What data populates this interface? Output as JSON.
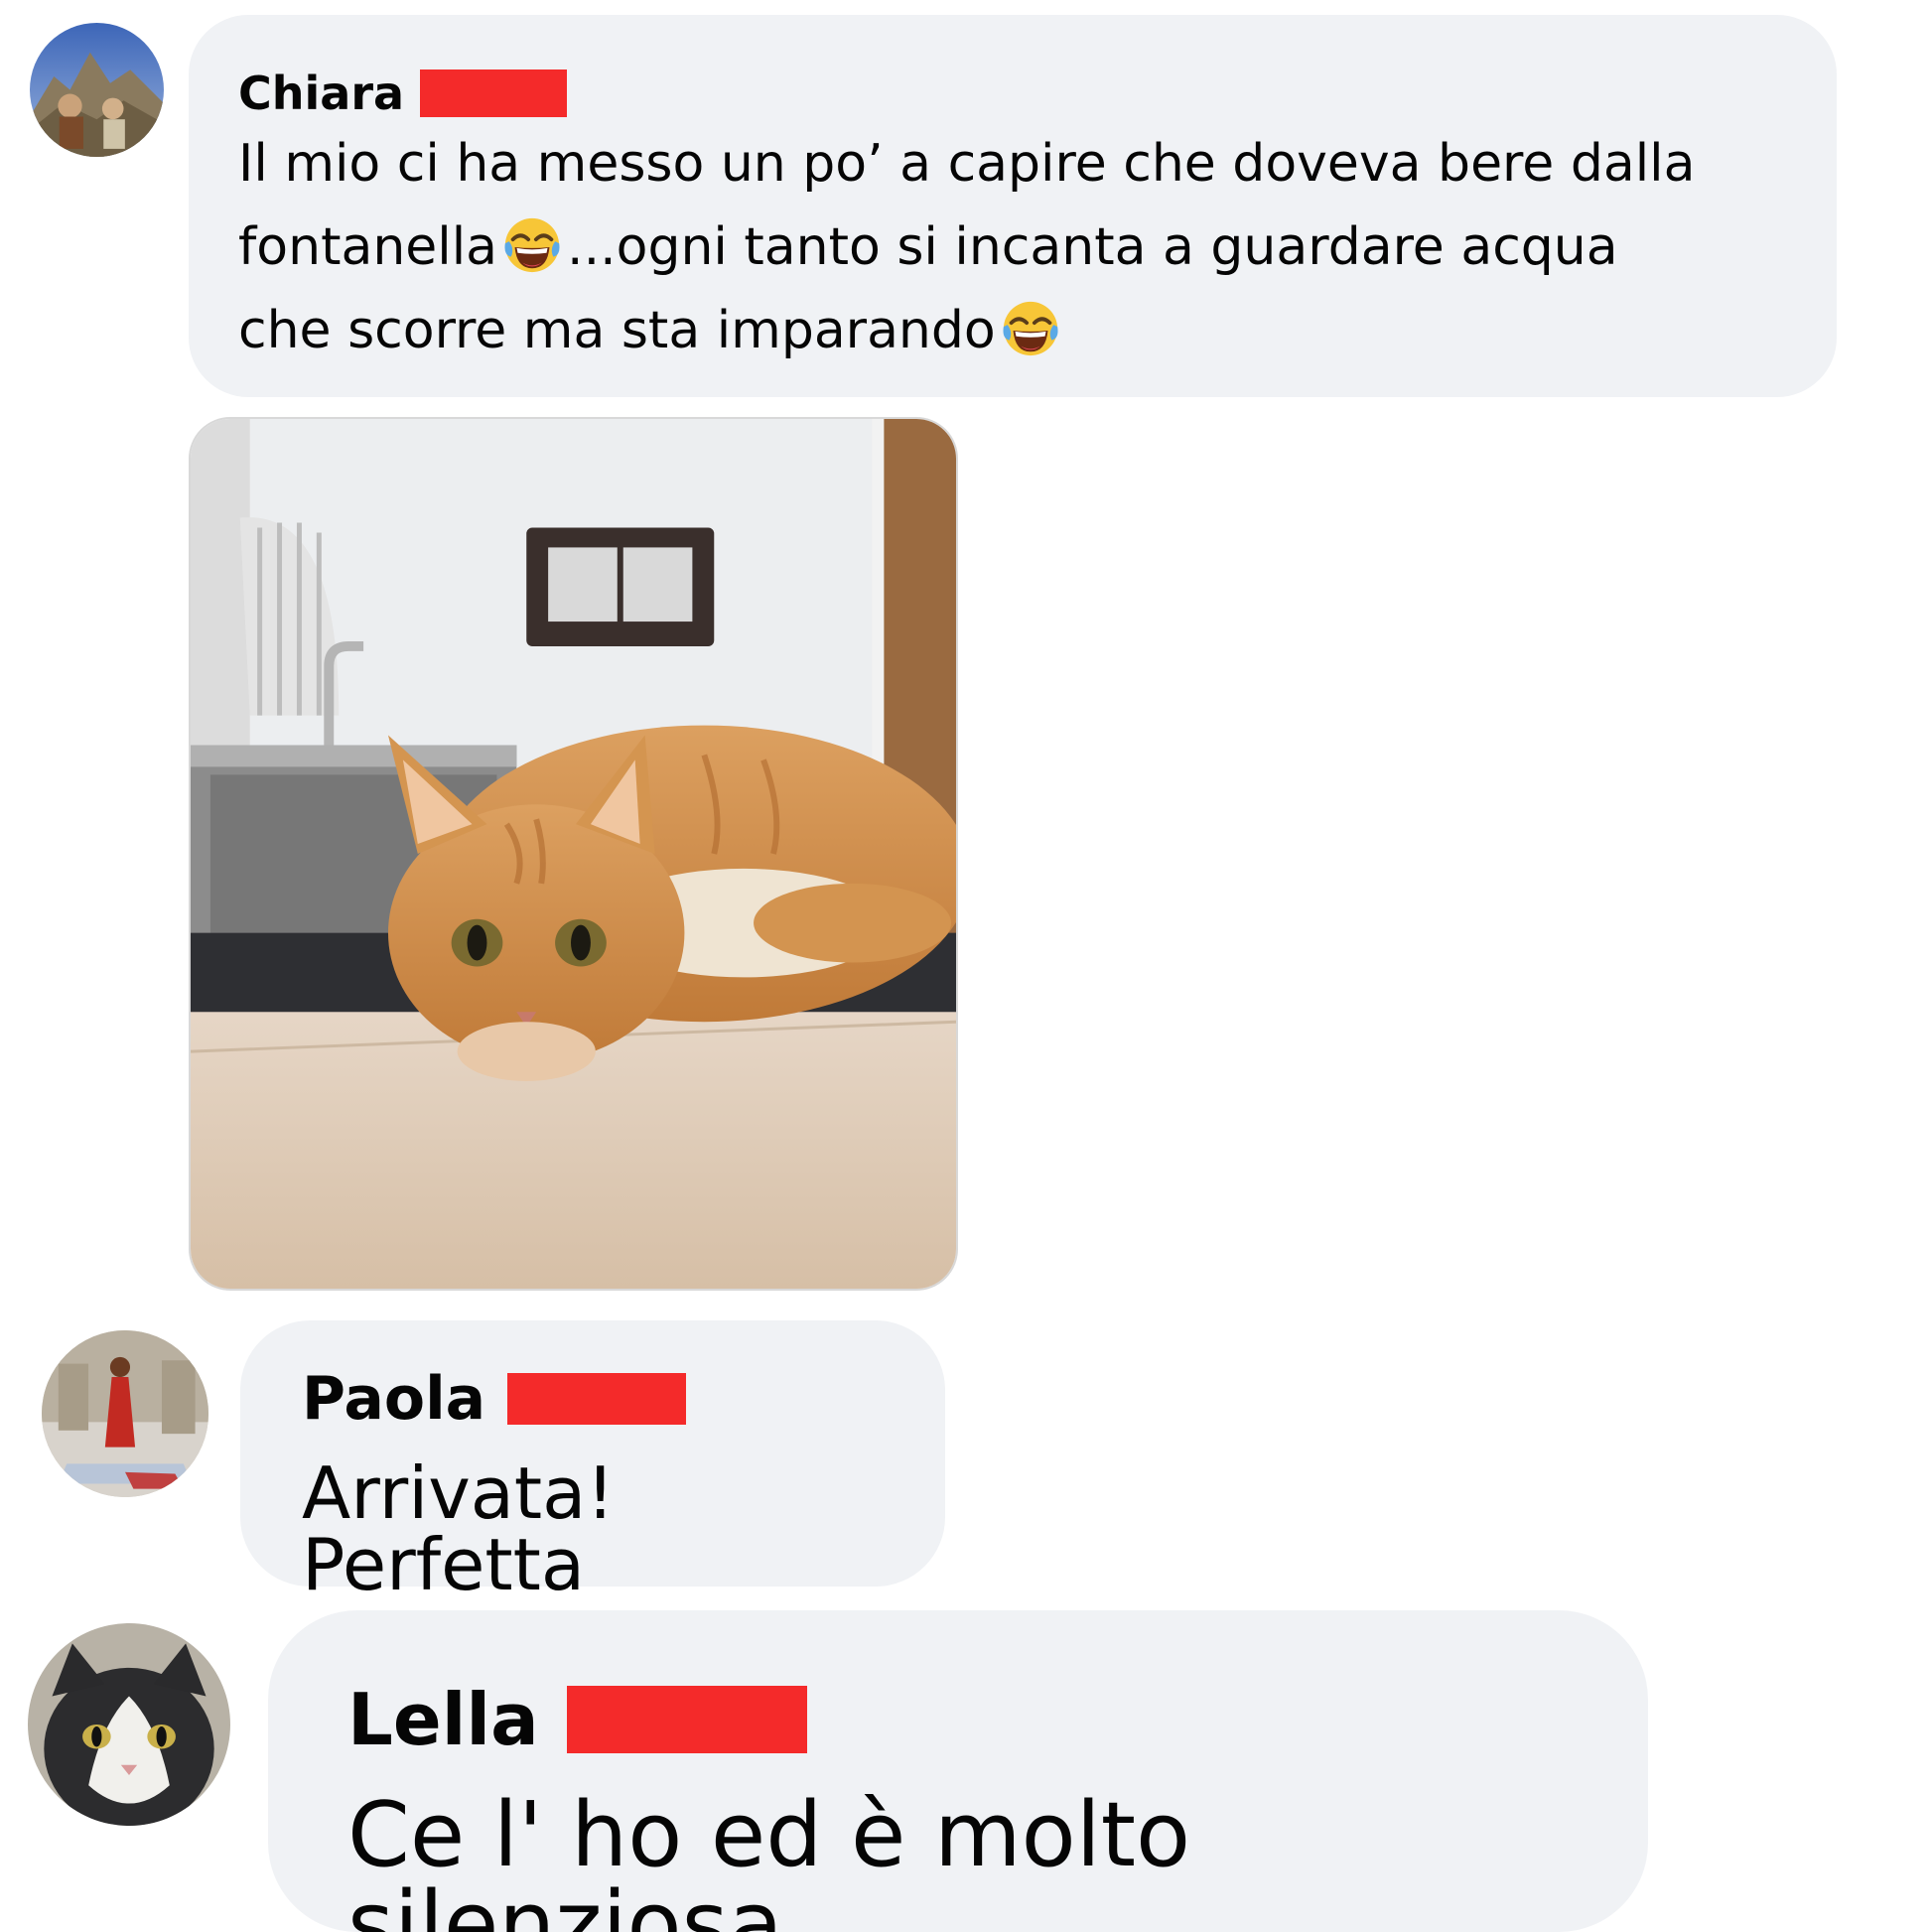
{
  "comments": [
    {
      "author": "Chiara",
      "text_lines": [
        "Il mio ci ha messo un po’ a capire che doveva bere dalla",
        "fontanella",
        "...ogni tanto si incanta a guardare acqua",
        "che scorre ma sta imparando"
      ],
      "emoji": "tears-of-joy",
      "has_photo": true
    },
    {
      "author": "Paola",
      "text": "Arrivata! Perfetta"
    },
    {
      "author": "Lella",
      "text": "Ce l' ho ed è molto silenziosa"
    }
  ],
  "colors": {
    "bubble_bg": "#f0f2f5",
    "redaction": "#f42a2a",
    "text": "#050505"
  }
}
